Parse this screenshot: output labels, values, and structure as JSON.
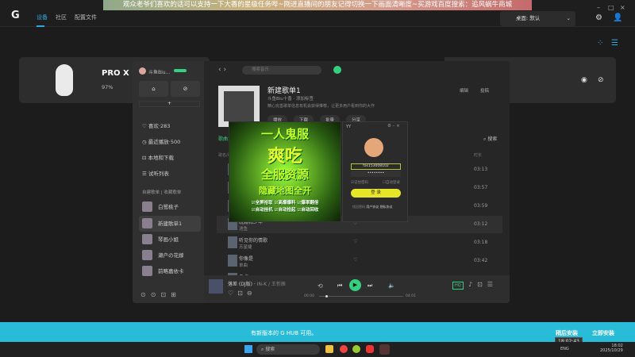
{
  "stream_banner": "观众老爷们喜欢的话可以支持一下大香的星级任务哔~刚进直播间的朋友记得切换一下画面清晰度~买游戏百度搜索：追风蜗牛商城",
  "ghub": {
    "logo": "G",
    "nav": [
      "设备",
      "社区",
      "配置文件"
    ],
    "profile": "桌面: 默认",
    "window_controls": [
      "–",
      "□",
      "×"
    ],
    "device": {
      "name": "PRO X SU",
      "battery": "97%"
    },
    "update": {
      "message": "有新版本的 G HUB 可用。",
      "later": "稍后安装",
      "now": "立即安装"
    }
  },
  "music": {
    "user": "斗鱼Biu...",
    "search_placeholder": "搜索音乐",
    "sidebar": {
      "items": [
        "喜欢·283",
        "最近播放·500",
        "本地和下载",
        "试听列表"
      ],
      "tabs": [
        "自建歌单",
        "收藏歌单"
      ],
      "add": "+",
      "playlists": [
        "白鹭桃子",
        "新建歌单1",
        "琴画小姐",
        "濑户の花嫁",
        "前略嘉依卡"
      ]
    },
    "playlist": {
      "title": "新建歌单1",
      "creator": "斗鱼Biu十香",
      "add_tag": "添加标签",
      "desc": "精心完善歌单信息有机会获得推荐，让更多用户看到你的大作",
      "edit": "编辑",
      "share_label": "投稿",
      "actions": [
        "播放",
        "下载",
        "批量",
        "分享"
      ],
      "tab": "歌曲1",
      "search": "搜索",
      "col_title": "歌名/歌手",
      "col_duration": "时长",
      "songs": [
        {
          "title": "",
          "artist": "",
          "duration": "03:13"
        },
        {
          "title": "女孩 (中文版)",
          "artist": "",
          "duration": "03:57"
        },
        {
          "title": "",
          "artist": "",
          "duration": "03:59"
        },
        {
          "title": "晚霞和少年",
          "artist": "池鱼",
          "duration": "03:12"
        },
        {
          "title": "听见你的情歌",
          "artist": "苏星婕",
          "duration": "03:18"
        },
        {
          "title": "你像是",
          "artist": "单曲",
          "duration": "03:42"
        },
        {
          "title": "几点",
          "artist": "",
          "duration": ""
        }
      ]
    },
    "player": {
      "title": "落差 (DJ版)",
      "artist": "IN-K / 王忻辰",
      "elapsed": "00:00",
      "total": "04:01",
      "progress": 0.0,
      "quality": "HQ"
    }
  },
  "ad": {
    "lines": [
      "一人鬼服",
      "爽吃",
      "全服资源",
      "隐藏地图全开"
    ],
    "features": [
      "全屏拾取",
      "高爆爆料",
      "爆率翻倍",
      "自动挂机",
      "自动捡起",
      "自动回收"
    ]
  },
  "login": {
    "app": "YY",
    "account": "fas153008102",
    "password": "••••••••",
    "remember": "记住密码",
    "auto": "自动登录",
    "button": "登 录",
    "find": "找回密码",
    "terms": "用户协议",
    "privacy": "隐私协议"
  },
  "taskbar": {
    "search": "搜索",
    "lang": "ENG",
    "time": "18:02",
    "date": "2025/10/29",
    "tooltip": "18:02:43"
  }
}
